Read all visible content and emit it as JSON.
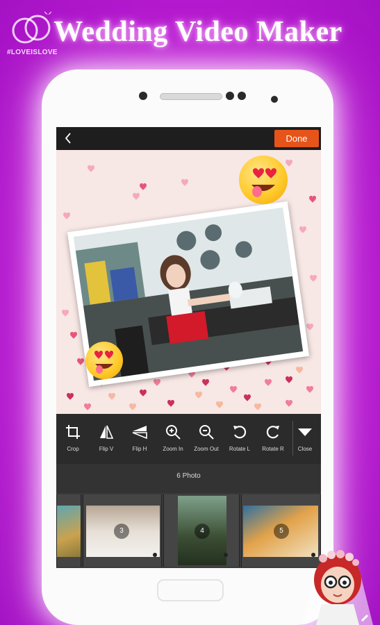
{
  "banner": {
    "title": "Wedding Video Maker",
    "logo_tag": "#LOVEISLOVE"
  },
  "screen": {
    "done_label": "Done",
    "tools": [
      {
        "label": "Crop",
        "icon": "crop-icon"
      },
      {
        "label": "Flip V",
        "icon": "flip-v-icon"
      },
      {
        "label": "Flip H",
        "icon": "flip-h-icon"
      },
      {
        "label": "Zoom In",
        "icon": "zoom-in-icon"
      },
      {
        "label": "Zoom Out",
        "icon": "zoom-out-icon"
      },
      {
        "label": "Rotate L",
        "icon": "rotate-left-icon"
      },
      {
        "label": "Rotate R",
        "icon": "rotate-right-icon"
      },
      {
        "label": "Close",
        "icon": "close-triangle-icon"
      }
    ],
    "photos_count": "6 Photo",
    "thumbnails": [
      {
        "number": ""
      },
      {
        "number": "3"
      },
      {
        "number": "4"
      },
      {
        "number": "5"
      }
    ]
  },
  "colors": {
    "accent": "#e6541a",
    "background": "#b41ccd",
    "toolbar": "#2b2b2b"
  }
}
